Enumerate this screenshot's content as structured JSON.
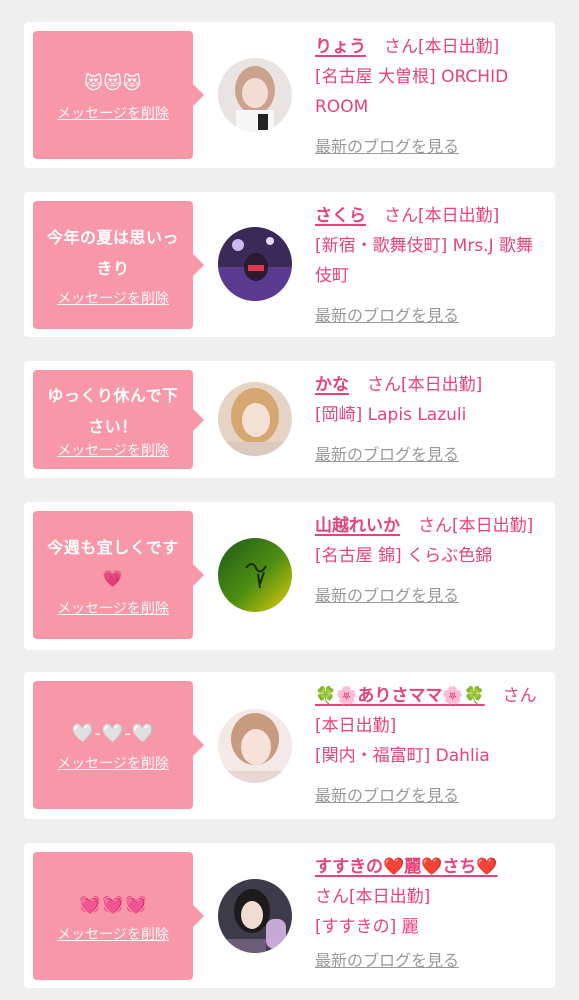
{
  "delete_label": "メッセージを削除",
  "blog_label": "最新のブログを見る",
  "honorific": "さん[本日出勤]",
  "colors": {
    "bubble": "#f797a8",
    "name": "#e8427a",
    "blog_link": "#999999",
    "page_bg": "#efefef",
    "card_bg": "#ffffff"
  },
  "entries": [
    {
      "message": "😻😻😻",
      "name": "りょう",
      "shop": "[名古屋 大曽根] ORCHID ROOM"
    },
    {
      "message": "今年の夏は思いっきり",
      "name": "さくら",
      "shop": "[新宿・歌舞伎町] Mrs.J 歌舞伎町"
    },
    {
      "message": "ゆっくり休んで下さい！",
      "name": "かな",
      "shop": "[岡崎] Lapis Lazuli"
    },
    {
      "message": "今週も宜しくです💗",
      "name": "山越れいか",
      "shop": "[名古屋 錦] くらぶ色錦"
    },
    {
      "message": "🤍-🤍-🤍",
      "name": "🍀🌸ありさママ🌸🍀",
      "shop": "[関内・福富町] Dahlia"
    },
    {
      "message": "💓💓💓",
      "name": "すすきの❤️麗❤️さち❤️",
      "shop": "[すすきの] 麗"
    }
  ]
}
